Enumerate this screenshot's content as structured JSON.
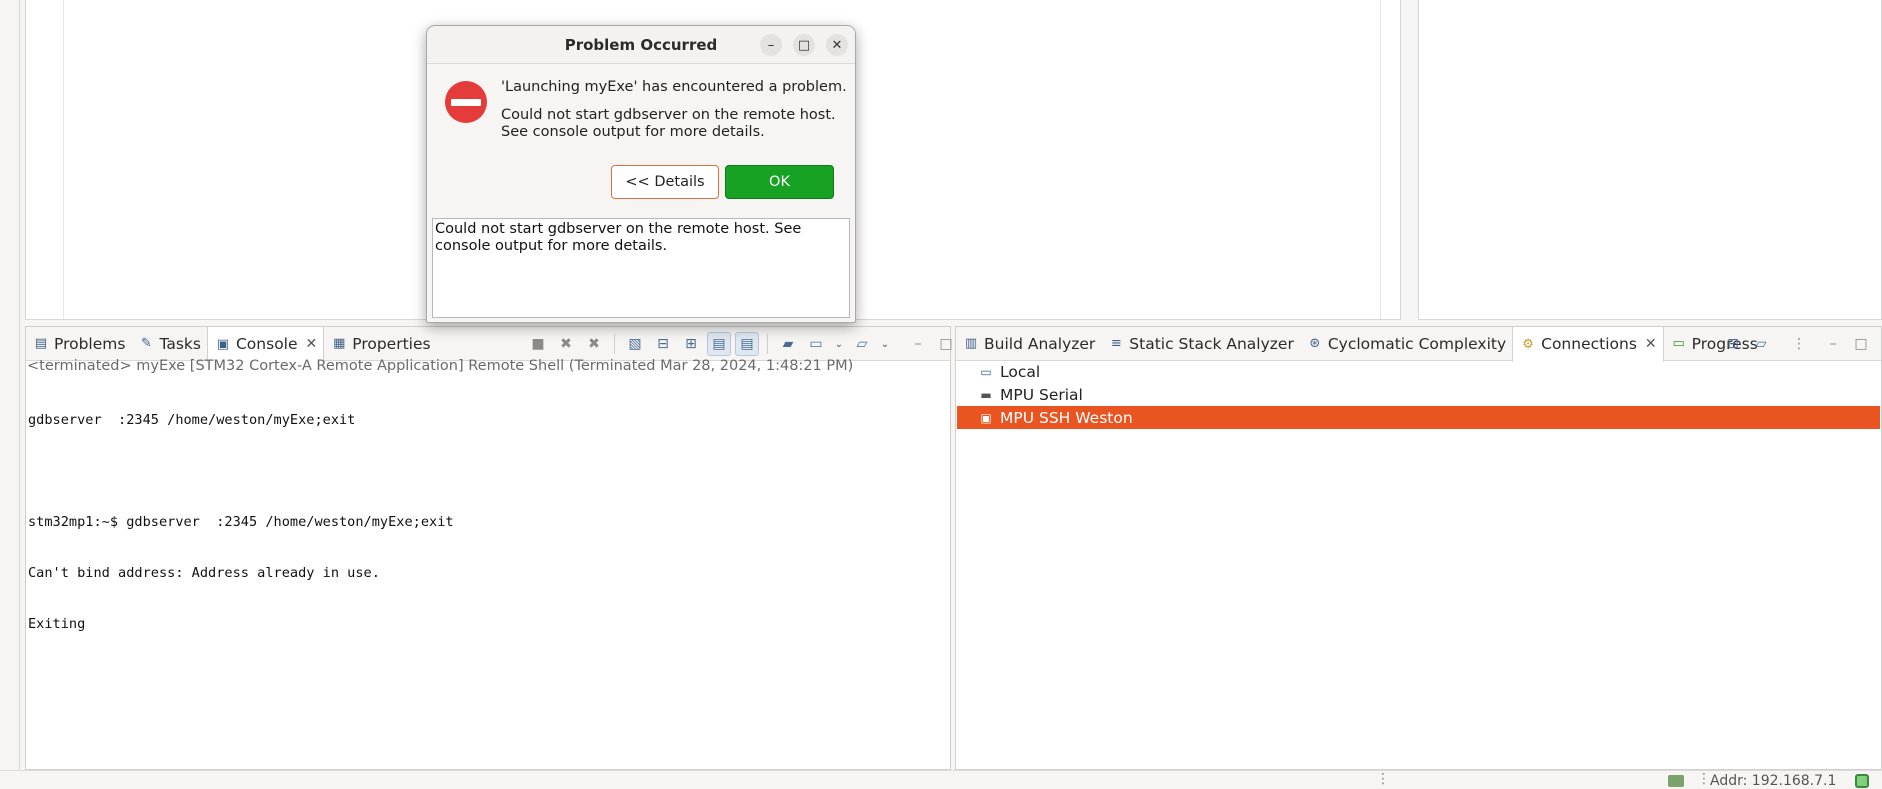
{
  "dialog": {
    "title": "Problem Occurred",
    "message_primary": "'Launching myExe' has encountered a problem.",
    "message_secondary": "Could not start gdbserver on the remote host. See console output for more details.",
    "details_button": "<< Details",
    "ok_button": "OK",
    "details_text": "Could not start gdbserver on the remote host. See console output for more details.",
    "minimize_glyph": "–",
    "maximize_glyph": "□",
    "close_glyph": "✕",
    "icon": "error-icon"
  },
  "console_panel": {
    "tabs": [
      {
        "label": "Problems",
        "icon": "problems-icon"
      },
      {
        "label": "Tasks",
        "icon": "tasks-icon"
      },
      {
        "label": "Console",
        "icon": "console-icon",
        "active": true
      },
      {
        "label": "Properties",
        "icon": "properties-icon"
      }
    ],
    "header": "<terminated> myExe [STM32 Cortex-A Remote Application] Remote Shell (Terminated Mar 28, 2024, 1:48:21 PM)",
    "lines": [
      "gdbserver  :2345 /home/weston/myExe;exit",
      "",
      "stm32mp1:~$ gdbserver  :2345 /home/weston/myExe;exit",
      "Can't bind address: Address already in use.",
      "Exiting"
    ]
  },
  "connections_panel": {
    "tabs": [
      {
        "label": "Build Analyzer",
        "icon": "build-analyzer-icon"
      },
      {
        "label": "Static Stack Analyzer",
        "icon": "stack-analyzer-icon"
      },
      {
        "label": "Cyclomatic Complexity",
        "icon": "cyclomatic-icon"
      },
      {
        "label": "Connections",
        "icon": "connections-icon",
        "active": true
      },
      {
        "label": "Progress",
        "icon": "progress-icon"
      }
    ],
    "items": [
      {
        "label": "Local",
        "icon": "local-computer-icon"
      },
      {
        "label": "MPU Serial",
        "icon": "serial-icon"
      },
      {
        "label": "MPU SSH Weston",
        "icon": "ssh-terminal-icon",
        "selected": true
      }
    ]
  },
  "status_bar": {
    "address": "Addr: 192.168.7.1"
  },
  "colors": {
    "selection": "#e95420",
    "ok_button": "#17a224",
    "error_icon": "#e43b3b"
  }
}
